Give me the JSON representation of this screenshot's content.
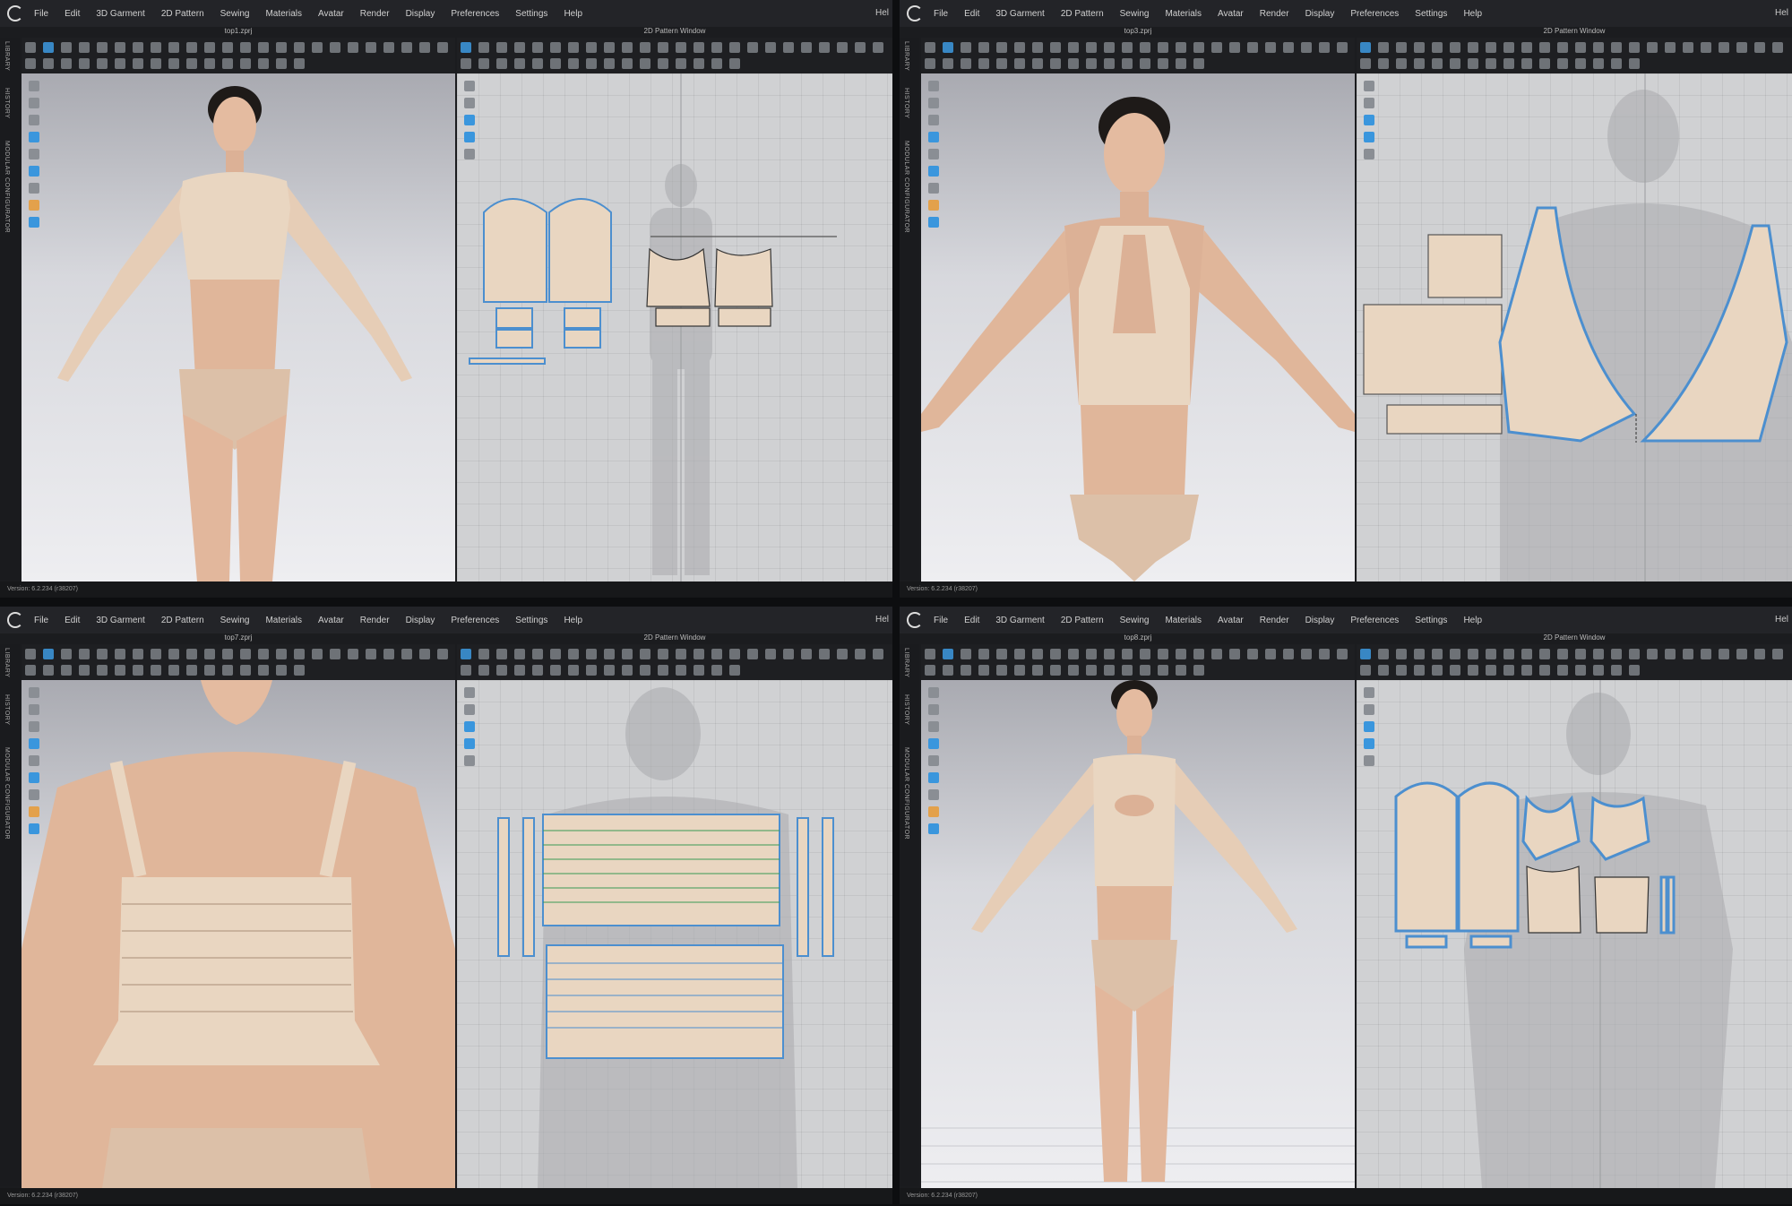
{
  "menu": [
    "File",
    "Edit",
    "3D Garment",
    "2D Pattern",
    "Sewing",
    "Materials",
    "Avatar",
    "Render",
    "Display",
    "Preferences",
    "Settings",
    "Help"
  ],
  "menu_right": "Hel",
  "side_tabs": [
    "LIBRARY",
    "HISTORY",
    "MODULAR CONFIGURATOR"
  ],
  "window_2d_title": "2D Pattern Window",
  "version": "Version: 6.2.234 (r38207)",
  "windows": [
    {
      "file": "top1.zprj"
    },
    {
      "file": "top3.zprj"
    },
    {
      "file": "top7.zprj"
    },
    {
      "file": "top8.zprj"
    }
  ],
  "colors": {
    "fabric": "#e9d6c1",
    "outline": "#4c8fcf",
    "skin": "#e0b69a",
    "ui_dark": "#1b1c1f"
  }
}
